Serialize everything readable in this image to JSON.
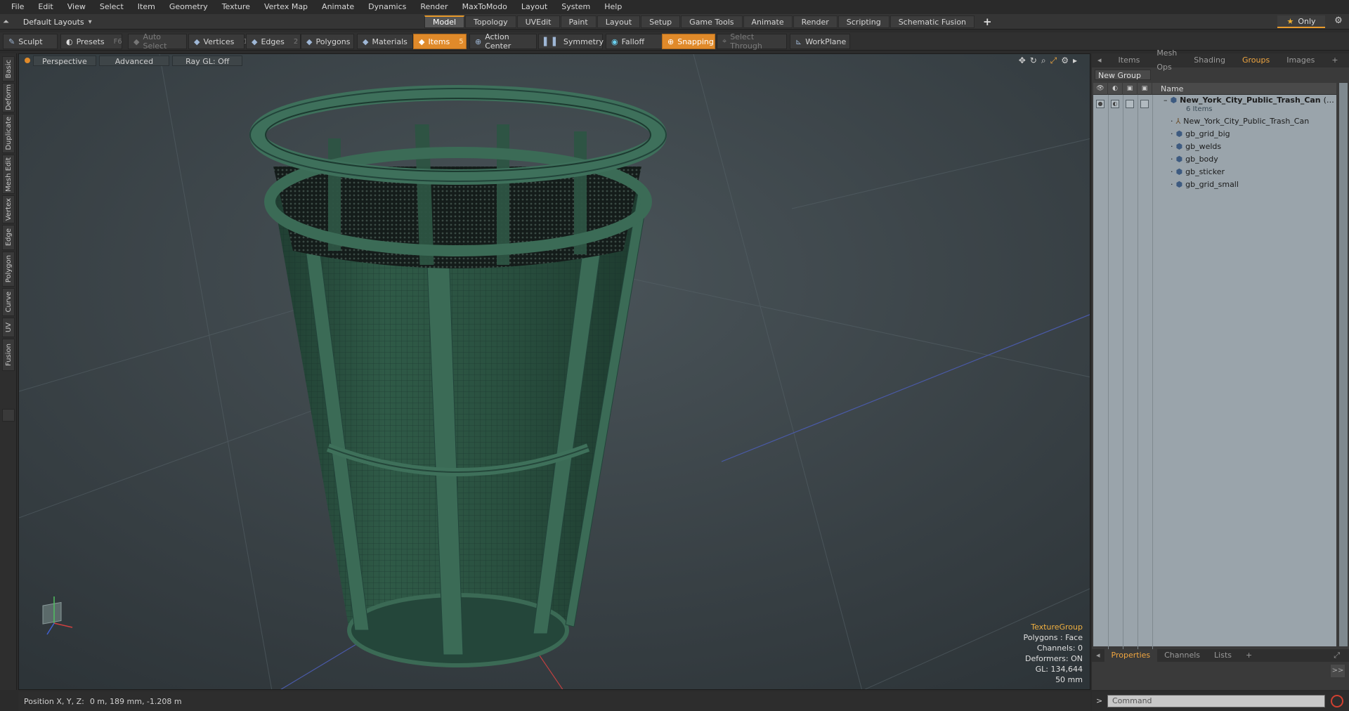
{
  "menu": [
    "File",
    "Edit",
    "View",
    "Select",
    "Item",
    "Geometry",
    "Texture",
    "Vertex Map",
    "Animate",
    "Dynamics",
    "Render",
    "MaxToModo",
    "Layout",
    "System",
    "Help"
  ],
  "layout_select": "Default Layouts",
  "layout_tabs": [
    "Model",
    "Topology",
    "UVEdit",
    "Paint",
    "Layout",
    "Setup",
    "Game Tools",
    "Animate",
    "Render",
    "Scripting",
    "Schematic Fusion"
  ],
  "layout_tab_active": "Model",
  "only_label": "Only",
  "toolbar": {
    "sculpt": "Sculpt",
    "presets": "Presets",
    "presets_key": "F6",
    "auto_select": "Auto Select",
    "vertices": "Vertices",
    "vertices_count": "1",
    "edges": "Edges",
    "edges_count": "2",
    "polygons": "Polygons",
    "materials": "Materials",
    "items": "Items",
    "items_count": "5",
    "action_center": "Action Center",
    "symmetry": "Symmetry",
    "falloff": "Falloff",
    "snapping": "Snapping",
    "select_through": "Select Through",
    "workplane": "WorkPlane"
  },
  "left_tabs": [
    "Basic",
    "Deform",
    "Duplicate",
    "Mesh Edit",
    "Vertex",
    "Edge",
    "Polygon",
    "Curve",
    "UV",
    "Fusion"
  ],
  "viewport": {
    "view": "Perspective",
    "shading": "Advanced",
    "raygl": "Ray GL: Off",
    "info": {
      "group": "TextureGroup",
      "polygons": "Polygons : Face",
      "channels": "Channels: 0",
      "deformers": "Deformers: ON",
      "gl": "GL: 134,644",
      "scale": "50 mm"
    }
  },
  "right_tabs": [
    "Items",
    "Mesh Ops",
    "Shading",
    "Groups",
    "Images"
  ],
  "right_tab_active": "Groups",
  "new_group": "New Group",
  "tree": {
    "name_header": "Name",
    "group_name": "New_York_City_Public_Trash_Can",
    "group_count": "6 Items",
    "children": [
      "New_York_City_Public_Trash_Can",
      "gb_grid_big",
      "gb_welds",
      "gb_body",
      "gb_sticker",
      "gb_grid_small"
    ]
  },
  "bottom_tabs": [
    "Properties",
    "Channels",
    "Lists"
  ],
  "bottom_tab_active": "Properties",
  "status": {
    "label": "Position X, Y, Z:",
    "value": "0 m, 189 mm, -1.208 m"
  },
  "command_placeholder": "Command",
  "colors": {
    "accent": "#e08a2a",
    "viewport_bg": "#3c474c",
    "mesh": "#2f5a47"
  }
}
